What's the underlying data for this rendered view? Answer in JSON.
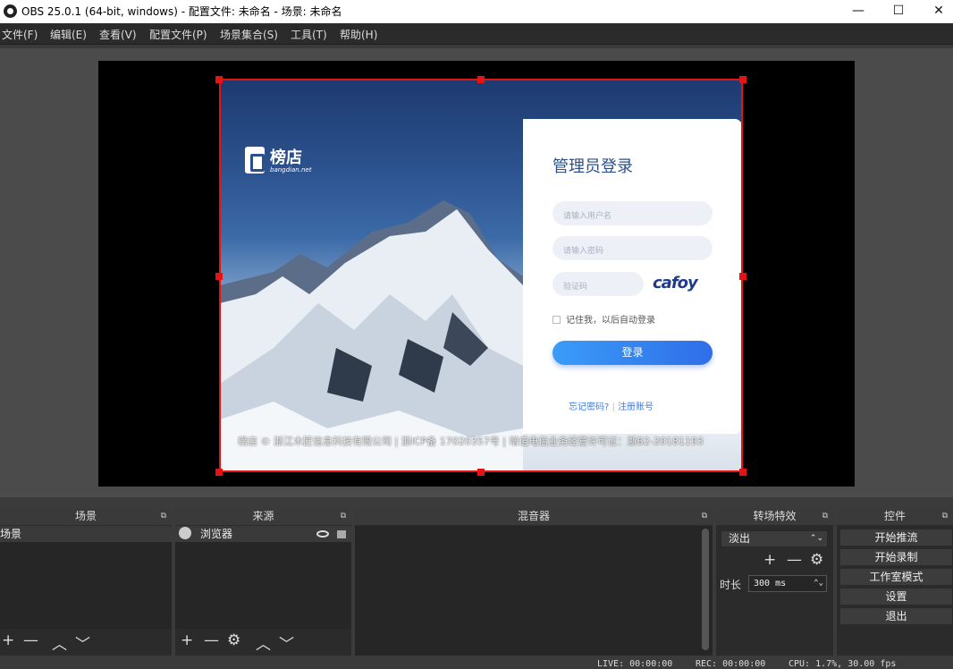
{
  "window": {
    "title": "OBS 25.0.1 (64-bit, windows) - 配置文件: 未命名 - 场景: 未命名",
    "minimize": "—",
    "maximize": "☐",
    "close": "✕"
  },
  "menu": [
    "文件(F)",
    "编辑(E)",
    "查看(V)",
    "配置文件(P)",
    "场景集合(S)",
    "工具(T)",
    "帮助(H)"
  ],
  "preview": {
    "logo_name": "榜店",
    "logo_sub": "bangdian.net",
    "login_title": "管理员登录",
    "username_placeholder": "请输入用户名",
    "password_placeholder": "请输入密码",
    "captcha_placeholder": "验证码",
    "captcha_text": "cafoy",
    "remember": "记住我，以后自动登录",
    "login_button": "登录",
    "forgot": "忘记密码?",
    "divider": "|",
    "register": "注册账号",
    "footer": "榜店 © 浙江木匠信息科技有限公司 | 浙ICP备 17020357号 | 增值电信业务经营许可证：浙B2-20181193"
  },
  "docks": {
    "scenes": {
      "title": "场景",
      "items": [
        "场景"
      ]
    },
    "sources": {
      "title": "来源",
      "items": [
        "浏览器"
      ]
    },
    "mixer": {
      "title": "混音器"
    },
    "transitions": {
      "title": "转场特效",
      "type": "淡出",
      "duration_label": "时长",
      "duration": "300 ms"
    },
    "controls": {
      "title": "控件",
      "buttons": [
        "开始推流",
        "开始录制",
        "工作室模式",
        "设置",
        "退出"
      ]
    }
  },
  "toolbar_icons": {
    "add": "+",
    "remove": "—",
    "settings": "⚙",
    "up": "︿",
    "down": "﹀",
    "float": "⧉"
  },
  "status": {
    "live": "LIVE: 00:00:00",
    "rec": "REC: 00:00:00",
    "cpu": "CPU: 1.7%, 30.00 fps"
  },
  "colors": {
    "selection": "#e51414",
    "accent": "#3a9cf8"
  }
}
